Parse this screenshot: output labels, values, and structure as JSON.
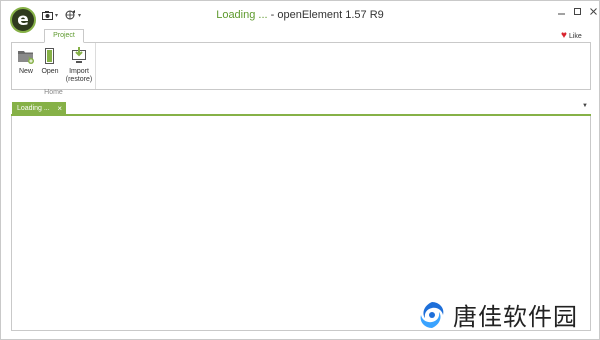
{
  "window": {
    "status_text": "Loading ...",
    "app_title": "openElement 1.57 R9",
    "logo_letter": "e"
  },
  "ribbon": {
    "tabs": [
      {
        "label": "Project"
      }
    ],
    "like_label": "Like",
    "groups": [
      {
        "label": "Home",
        "buttons": [
          {
            "label": "New",
            "icon": "new-folder-icon"
          },
          {
            "label": "Open",
            "icon": "open-book-icon"
          },
          {
            "label_line1": "Import",
            "label_line2": "(restore)",
            "icon": "import-computer-icon"
          }
        ]
      }
    ]
  },
  "documents": {
    "tabs": [
      {
        "label": "Loading ...",
        "close": "×"
      }
    ]
  },
  "watermark": {
    "text": "唐佳软件园",
    "icon": "swirl-logo-icon"
  },
  "colors": {
    "accent_green": "#86b147",
    "status_green": "#5e9a2e",
    "heart_red": "#d9232d",
    "watermark_blue": "#1e6fd9"
  }
}
